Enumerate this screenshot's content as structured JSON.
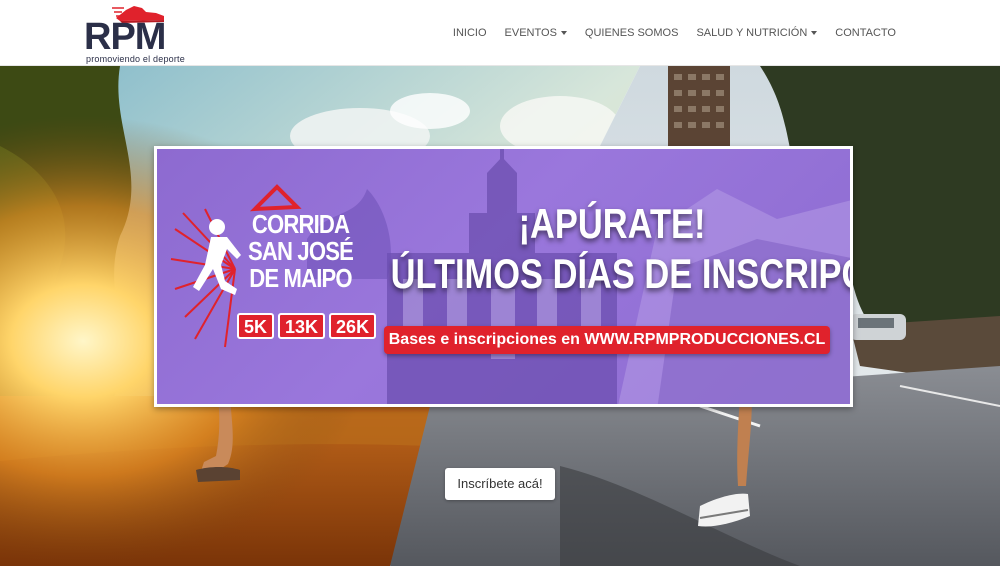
{
  "brand": {
    "name": "RPM",
    "tagline": "promoviendo el deporte",
    "accent_color": "#e0222c",
    "text_color": "#2b2f48"
  },
  "nav": {
    "items": [
      {
        "label": "INICIO",
        "dropdown": false
      },
      {
        "label": "EVENTOS",
        "dropdown": true
      },
      {
        "label": "QUIENES SOMOS",
        "dropdown": false
      },
      {
        "label": "SALUD Y NUTRICIÓN",
        "dropdown": true
      },
      {
        "label": "CONTACTO",
        "dropdown": false
      }
    ]
  },
  "banner": {
    "race_line1": "CORRIDA",
    "race_line2": "SAN JOSÉ",
    "race_line3": "DE MAIPO",
    "distances": [
      "5K",
      "13K",
      "26K"
    ],
    "headline1": "¡APÚRATE!",
    "headline2": "ÚLTIMOS DÍAS DE INSCRIPCIÓN",
    "url_text": "Bases e inscripciones en WWW.RPMPRODUCCIONES.CL",
    "purple": "#9a77dc"
  },
  "cta": {
    "label": "Inscríbete acá!"
  }
}
